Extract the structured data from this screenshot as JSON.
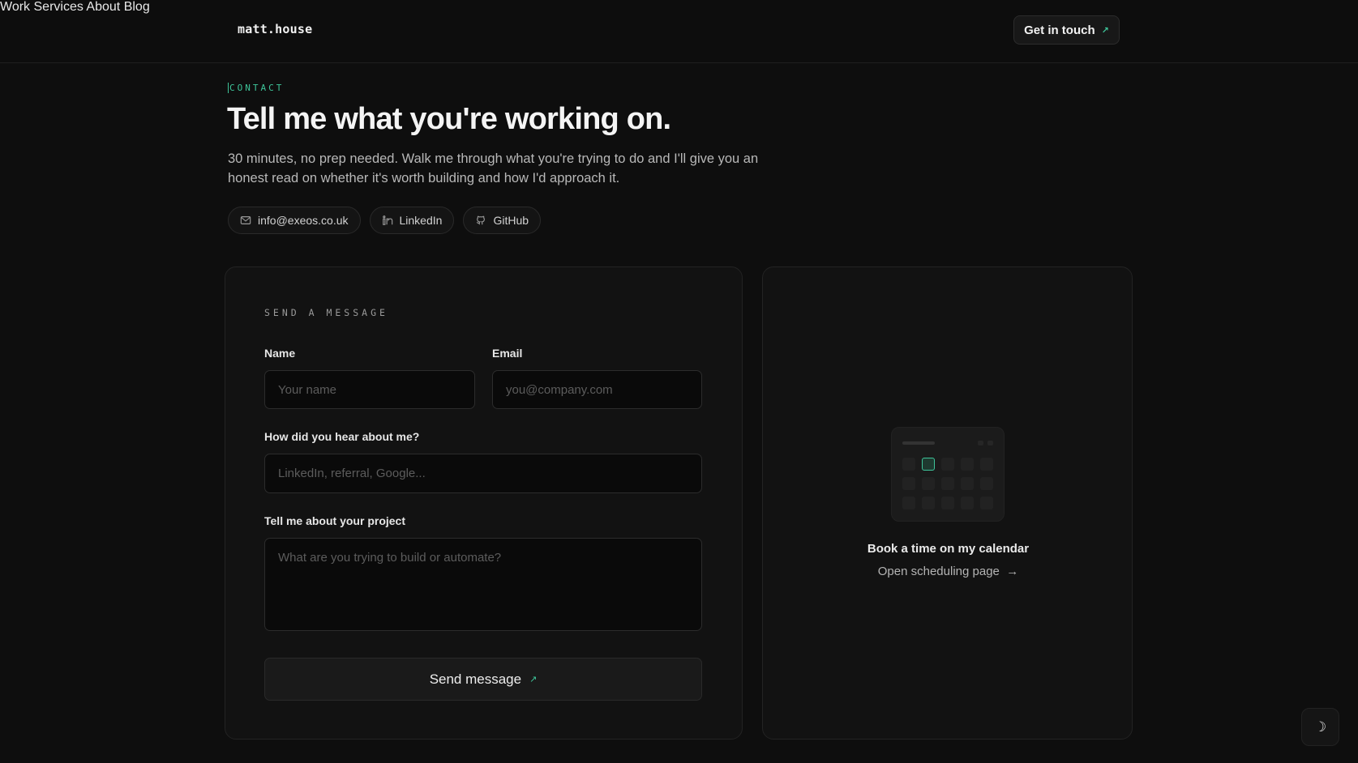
{
  "header": {
    "logo": "matt.house",
    "nav": [
      {
        "label": "Work"
      },
      {
        "label": "Services"
      },
      {
        "label": "About"
      },
      {
        "label": "Blog"
      }
    ],
    "cta_label": "Get in touch"
  },
  "hero": {
    "eyebrow": "CONTACT",
    "title": "Tell me what you're working on.",
    "lede": "30 minutes, no prep needed. Walk me through what you're trying to do and I'll give you an honest read on whether it's worth building and how I'd approach it.",
    "chips": [
      {
        "label": "info@exeos.co.uk",
        "icon": "mail-icon"
      },
      {
        "label": "LinkedIn",
        "icon": "linkedin-icon"
      },
      {
        "label": "GitHub",
        "icon": "github-icon"
      }
    ]
  },
  "form": {
    "section_label": "SEND A MESSAGE",
    "name": {
      "label": "Name",
      "placeholder": "Your name",
      "value": ""
    },
    "email": {
      "label": "Email",
      "placeholder": "you@company.com",
      "value": ""
    },
    "source": {
      "label": "How did you hear about me?",
      "placeholder": "LinkedIn, referral, Google...",
      "value": ""
    },
    "project": {
      "label": "Tell me about your project",
      "placeholder": "What are you trying to build or automate?",
      "value": ""
    },
    "submit_label": "Send message"
  },
  "calendar": {
    "title": "Book a time on my calendar",
    "link_label": "Open scheduling page"
  },
  "colors": {
    "background": "#0e0e0e",
    "accent": "#3ec59a",
    "card": "#121212"
  },
  "theme_toggle": {
    "icon": "moon-icon"
  }
}
